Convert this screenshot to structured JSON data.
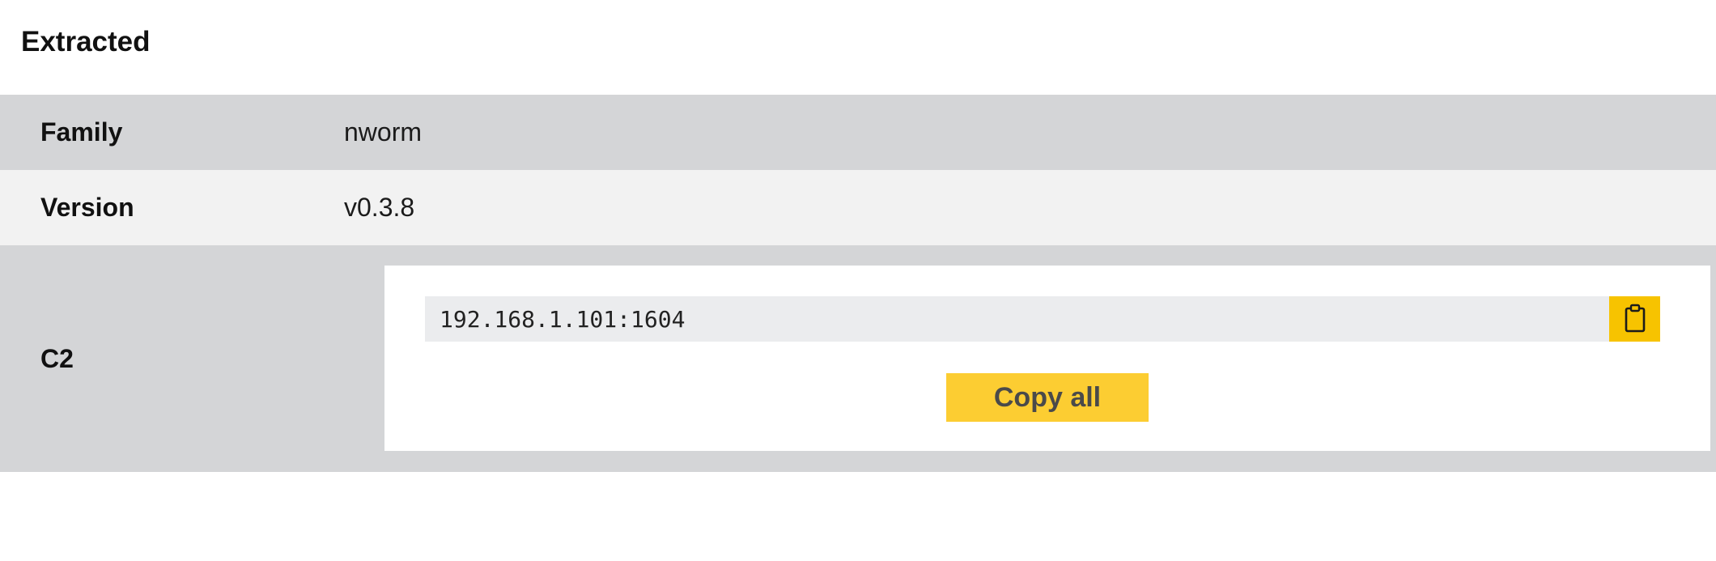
{
  "section": {
    "title": "Extracted"
  },
  "fields": [
    {
      "key": "Family",
      "value": "nworm"
    },
    {
      "key": "Version",
      "value": "v0.3.8"
    },
    {
      "key": "C2"
    }
  ],
  "c2": {
    "entries": [
      "192.168.1.101:1604"
    ],
    "copy_icon": "clipboard-icon",
    "copy_all_label": "Copy all"
  },
  "colors": {
    "row_dark": "#d4d5d7",
    "row_light": "#f2f2f2",
    "accent_yellow": "#fccd32",
    "icon_button_yellow": "#f7c300",
    "entry_background": "#ebecee"
  }
}
